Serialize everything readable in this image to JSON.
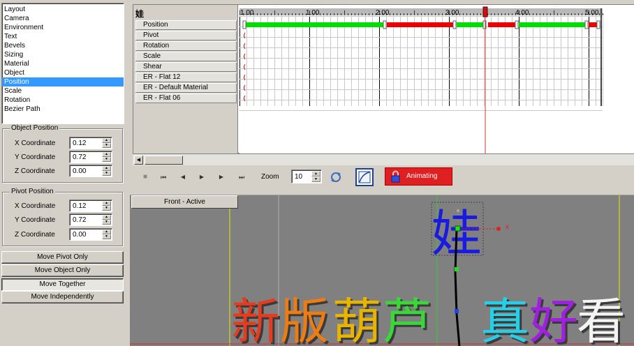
{
  "categories": [
    "Layout",
    "Camera",
    "Environment",
    "Text",
    "Bevels",
    "Sizing",
    "Material",
    "Object",
    "Position",
    "Scale",
    "Rotation",
    "Bezier Path"
  ],
  "selected_category_index": 8,
  "object_position": {
    "title": "Object Position",
    "rows": [
      {
        "label": "X Coordinate",
        "value": "0.12"
      },
      {
        "label": "Y Coordinate",
        "value": "0.72"
      },
      {
        "label": "Z Coordinate",
        "value": "0.00"
      }
    ]
  },
  "pivot_position": {
    "title": "Pivot Position",
    "rows": [
      {
        "label": "X Coordinate",
        "value": "0.12"
      },
      {
        "label": "Y Coordinate",
        "value": "0.72"
      },
      {
        "label": "Z Coordinate",
        "value": "0.00"
      }
    ]
  },
  "buttons": {
    "move_pivot_only": "Move Pivot Only",
    "move_object_only": "Move Object Only",
    "move_together": "Move Together",
    "move_independently": "Move Independently"
  },
  "timeline": {
    "title": "娃",
    "tracks": [
      "Position",
      "Pivot",
      "Rotation",
      "Scale",
      "Shear",
      "ER - Flat 12",
      "ER - Default Material",
      "ER - Flat 06"
    ],
    "ruler_labels": [
      "1.00",
      "1.00",
      "2.00",
      "3.00",
      "4.00",
      "5.00"
    ],
    "position_segments": [
      {
        "color": "#00dd00"
      },
      {
        "color": "#ee0000"
      },
      {
        "color": "#00dd00"
      },
      {
        "color": "#ee0000"
      },
      {
        "color": "#00dd00"
      },
      {
        "color": "#ee0000"
      }
    ]
  },
  "toolbar": {
    "zoom_label": "Zoom",
    "zoom_value": "10",
    "animating_label": "Animating",
    "stop_icon": "■",
    "first_icon": "⏮",
    "prev_icon": "◀",
    "play_icon": "▶",
    "next_icon": "▶",
    "last_icon": "⏭"
  },
  "viewport": {
    "view_label": "Front - Active",
    "axis_label": "x",
    "selected_char": "娃",
    "text_chars": [
      {
        "char": "新",
        "color": "#e53b1f"
      },
      {
        "char": "版",
        "color": "#ee7c10"
      },
      {
        "char": "葫",
        "color": "#e8b400"
      },
      {
        "char": "芦",
        "color": "#38d838"
      },
      {
        "char": "真",
        "color": "#24d0e8"
      },
      {
        "char": "好",
        "color": "#a020e0"
      },
      {
        "char": "看",
        "color": "#f4f4f4"
      }
    ]
  },
  "colors": {
    "selection": "#3399ff",
    "anim_button": "#e02020",
    "keyframe_green": "#00dd00",
    "keyframe_red": "#ee0000",
    "viewport_bg": "#808080"
  }
}
